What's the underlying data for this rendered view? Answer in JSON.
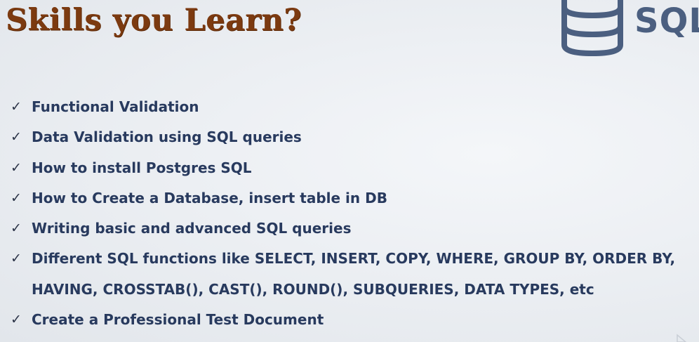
{
  "slide": {
    "title": "Skills you Learn?",
    "logo": {
      "text": "SQL",
      "icon": "database-icon",
      "color": "#4b5f80"
    },
    "check_glyph": "✓",
    "skills": [
      "Functional Validation",
      "Data Validation using SQL queries",
      "How to install Postgres SQL",
      "How to Create a Database, insert table in DB",
      "Writing basic and advanced SQL queries",
      "Different SQL functions like SELECT, INSERT, COPY, WHERE, GROUP BY, ORDER BY,",
      "HAVING, CROSSTAB(), CAST(), ROUND(), SUBQUERIES, DATA TYPES, etc",
      "Create a Professional Test Document"
    ],
    "title_color": "#7c3a10",
    "text_color": "#283a5e"
  }
}
